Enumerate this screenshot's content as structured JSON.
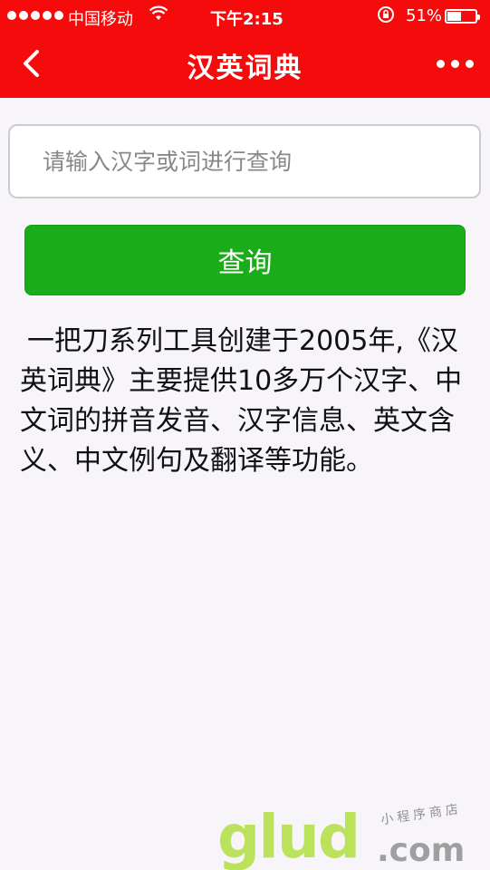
{
  "status_bar": {
    "carrier": "中国移动",
    "time": "下午2:15",
    "battery_percent": "51%",
    "battery_level": 0.51,
    "icons": [
      "signal-dots-icon",
      "wifi-icon",
      "rotation-lock-icon",
      "battery-icon"
    ]
  },
  "nav": {
    "title": "汉英词典",
    "back_icon": "chevron-left-icon",
    "more_icon": "more-dots-icon"
  },
  "search": {
    "placeholder": "请输入汉字或词进行查询",
    "value": ""
  },
  "query_button": {
    "label": "查询"
  },
  "description": "一把刀系列工具创建于2005年,《汉英词典》主要提供10多万个汉字、中文词的拼音发音、汉字信息、英文含义、中文例句及翻译等功能。",
  "watermark": {
    "main": "glud",
    "suffix": ".com",
    "tagline": "小程序商店"
  },
  "colors": {
    "nav_bg": "#f50b0b",
    "button_bg": "#1aad19",
    "page_bg": "#f7f5fa"
  }
}
